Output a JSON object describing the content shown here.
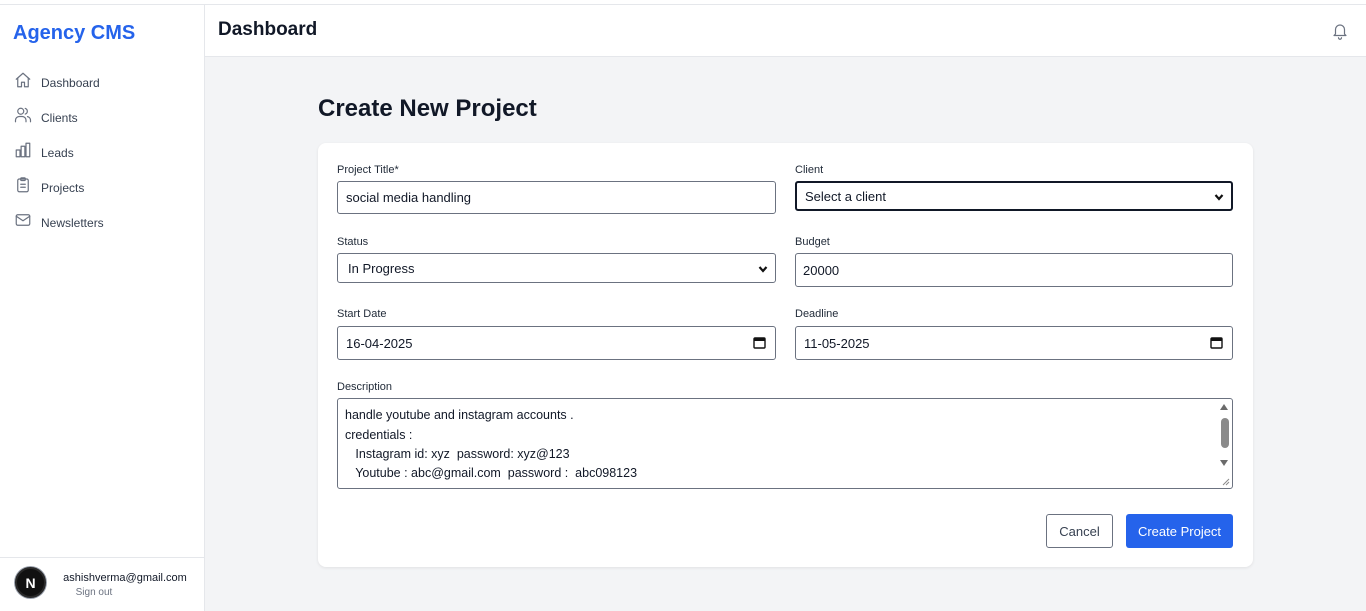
{
  "app": {
    "brand": "Agency CMS"
  },
  "sidebar": {
    "items": [
      {
        "label": "Dashboard",
        "icon": "home-icon"
      },
      {
        "label": "Clients",
        "icon": "users-icon"
      },
      {
        "label": "Leads",
        "icon": "bar-chart-icon"
      },
      {
        "label": "Projects",
        "icon": "clipboard-icon"
      },
      {
        "label": "Newsletters",
        "icon": "mail-icon"
      }
    ],
    "user": {
      "avatar_letter": "N",
      "email": "ashishverma@gmail.com",
      "sign_out": "Sign out"
    }
  },
  "header": {
    "title": "Dashboard",
    "icon": "bell-icon"
  },
  "main": {
    "page_title": "Create New Project",
    "form": {
      "title_label": "Project Title*",
      "title_value": "social media handling",
      "client_label": "Client",
      "client_value": "Select a client",
      "status_label": "Status",
      "status_value": "In Progress",
      "budget_label": "Budget",
      "budget_value": "20000",
      "start_label": "Start Date",
      "start_value": "16-04-2025",
      "deadline_label": "Deadline",
      "deadline_value": "11-05-2025",
      "description_label": "Description",
      "description_lines": [
        "handle youtube and instagram accounts .",
        "credentials :",
        "   Instagram id: xyz  password: xyz@123",
        "   Youtube : abc@gmail.com  password :  abc098123"
      ],
      "cancel_label": "Cancel",
      "submit_label": "Create Project"
    }
  },
  "colors": {
    "accent": "#2563eb",
    "background": "#f3f4f6"
  }
}
